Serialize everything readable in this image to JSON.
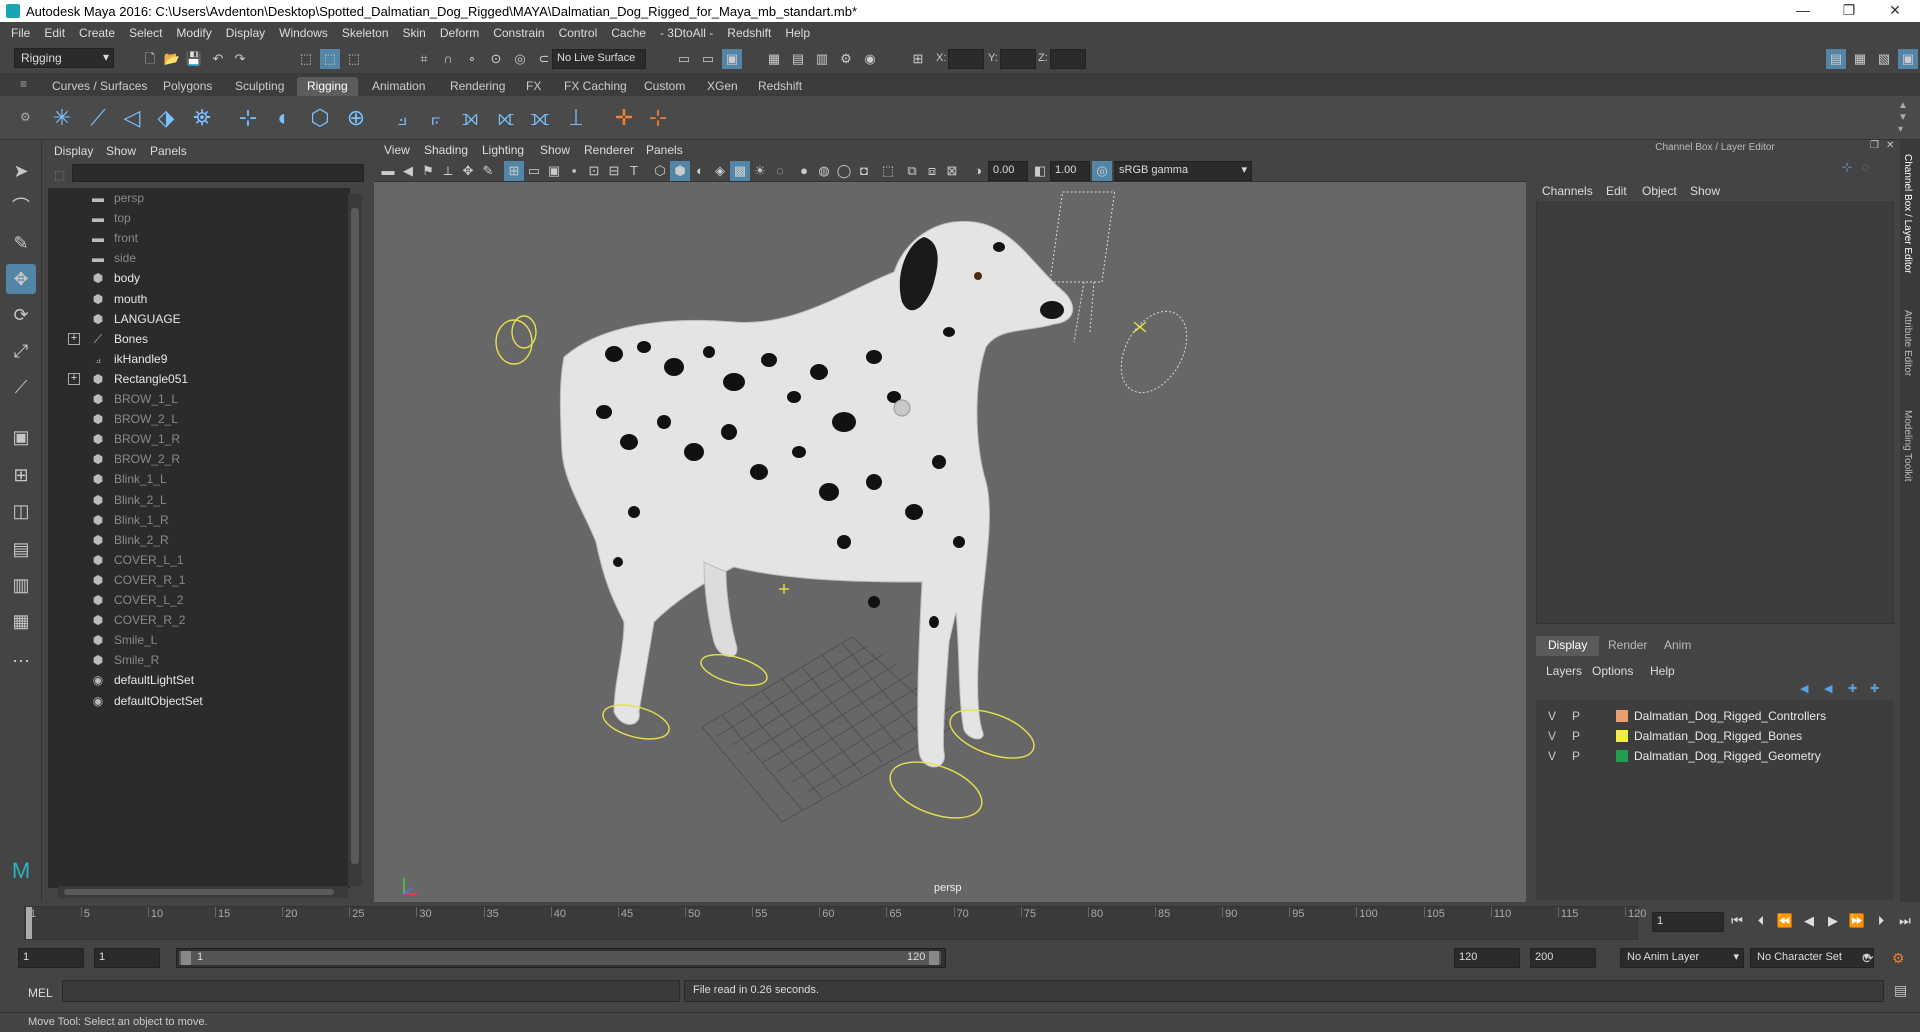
{
  "window": {
    "title": "Autodesk Maya 2016: C:\\Users\\Avdenton\\Desktop\\Spotted_Dalmatian_Dog_Rigged\\MAYA\\Dalmatian_Dog_Rigged_for_Maya_mb_standart.mb*",
    "minimize": "—",
    "maximize": "❐",
    "close": "✕"
  },
  "menubar": [
    "File",
    "Edit",
    "Create",
    "Select",
    "Modify",
    "Display",
    "Windows",
    "Skeleton",
    "Skin",
    "Deform",
    "Constrain",
    "Control",
    "Cache",
    "- 3DtoAll -",
    "Redshift",
    "Help"
  ],
  "statusline": {
    "mode": "Rigging",
    "live_surface": "No Live Surface",
    "x_label": "X:",
    "y_label": "Y:",
    "z_label": "Z:"
  },
  "shelf_tabs": [
    "Curves / Surfaces",
    "Polygons",
    "Sculpting",
    "Rigging",
    "Animation",
    "Rendering",
    "FX",
    "FX Caching",
    "Custom",
    "XGen",
    "Redshift"
  ],
  "shelf_active": "Rigging",
  "outliner": {
    "menu": [
      "Display",
      "Show",
      "Panels"
    ],
    "items": [
      {
        "label": "persp",
        "icon": "camera-icon",
        "dim": true,
        "expand": false
      },
      {
        "label": "top",
        "icon": "camera-icon",
        "dim": true,
        "expand": false
      },
      {
        "label": "front",
        "icon": "camera-icon",
        "dim": true,
        "expand": false
      },
      {
        "label": "side",
        "icon": "camera-icon",
        "dim": true,
        "expand": false
      },
      {
        "label": "body",
        "icon": "mesh-icon",
        "dim": false,
        "expand": false
      },
      {
        "label": "mouth",
        "icon": "mesh-icon",
        "dim": false,
        "expand": false
      },
      {
        "label": "LANGUAGE",
        "icon": "mesh-icon",
        "dim": false,
        "expand": false
      },
      {
        "label": "Bones",
        "icon": "joint-icon",
        "dim": false,
        "expand": true
      },
      {
        "label": "ikHandle9",
        "icon": "ik-handle-icon",
        "dim": false,
        "expand": false
      },
      {
        "label": "Rectangle051",
        "icon": "mesh-icon",
        "dim": false,
        "expand": true
      },
      {
        "label": "BROW_1_L",
        "icon": "mesh-icon",
        "dim": true,
        "expand": false
      },
      {
        "label": "BROW_2_L",
        "icon": "mesh-icon",
        "dim": true,
        "expand": false
      },
      {
        "label": "BROW_1_R",
        "icon": "mesh-icon",
        "dim": true,
        "expand": false
      },
      {
        "label": "BROW_2_R",
        "icon": "mesh-icon",
        "dim": true,
        "expand": false
      },
      {
        "label": "Blink_1_L",
        "icon": "mesh-icon",
        "dim": true,
        "expand": false
      },
      {
        "label": "Blink_2_L",
        "icon": "mesh-icon",
        "dim": true,
        "expand": false
      },
      {
        "label": "Blink_1_R",
        "icon": "mesh-icon",
        "dim": true,
        "expand": false
      },
      {
        "label": "Blink_2_R",
        "icon": "mesh-icon",
        "dim": true,
        "expand": false
      },
      {
        "label": "COVER_L_1",
        "icon": "mesh-icon",
        "dim": true,
        "expand": false
      },
      {
        "label": "COVER_R_1",
        "icon": "mesh-icon",
        "dim": true,
        "expand": false
      },
      {
        "label": "COVER_L_2",
        "icon": "mesh-icon",
        "dim": true,
        "expand": false
      },
      {
        "label": "COVER_R_2",
        "icon": "mesh-icon",
        "dim": true,
        "expand": false
      },
      {
        "label": "Smile_L",
        "icon": "mesh-icon",
        "dim": true,
        "expand": false
      },
      {
        "label": "Smile_R",
        "icon": "mesh-icon",
        "dim": true,
        "expand": false
      },
      {
        "label": "defaultLightSet",
        "icon": "set-icon",
        "dim": false,
        "expand": false
      },
      {
        "label": "defaultObjectSet",
        "icon": "set-icon",
        "dim": false,
        "expand": false
      }
    ]
  },
  "viewport": {
    "menu": [
      "View",
      "Shading",
      "Lighting",
      "Show",
      "Renderer",
      "Panels"
    ],
    "exposure": "0.00",
    "gamma": "1.00",
    "color_space": "sRGB gamma",
    "camera_label": "persp"
  },
  "channel_box": {
    "title": "Channel Box / Layer Editor",
    "menu": [
      "Channels",
      "Edit",
      "Object",
      "Show"
    ],
    "layer_tabs": [
      "Display",
      "Render",
      "Anim"
    ],
    "layer_tab_active": "Display",
    "layer_menu": [
      "Layers",
      "Options",
      "Help"
    ],
    "layers": [
      {
        "v": "V",
        "p": "P",
        "color": "#e8a070",
        "name": "Dalmatian_Dog_Rigged_Controllers"
      },
      {
        "v": "V",
        "p": "P",
        "color": "#f0f040",
        "name": "Dalmatian_Dog_Rigged_Bones"
      },
      {
        "v": "V",
        "p": "P",
        "color": "#20a050",
        "name": "Dalmatian_Dog_Rigged_Geometry"
      }
    ]
  },
  "side_tabs": [
    "Channel Box / Layer Editor",
    "Attribute Editor",
    "Modeling Toolkit"
  ],
  "timeline": {
    "ticks": [
      "1",
      "5",
      "10",
      "15",
      "20",
      "25",
      "30",
      "35",
      "40",
      "45",
      "50",
      "55",
      "60",
      "65",
      "70",
      "75",
      "80",
      "85",
      "90",
      "95",
      "100",
      "105",
      "110",
      "115",
      "120"
    ],
    "current_frame": "1"
  },
  "range": {
    "start": "1",
    "playback_start": "1",
    "slider_start": "1",
    "slider_end": "120",
    "playback_end": "120",
    "end": "200",
    "anim_layer": "No Anim Layer",
    "char_set": "No Character Set"
  },
  "command": {
    "lang": "MEL",
    "result": "File read in  0.26 seconds."
  },
  "help_line": "Move Tool: Select an object to move."
}
